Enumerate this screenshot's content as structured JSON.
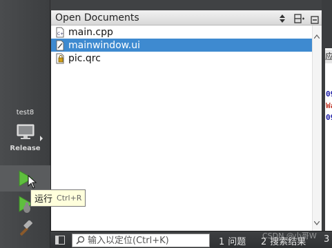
{
  "sidebar": {
    "kit_name": "test8",
    "build_config": "Release",
    "run_tooltip": {
      "label": "运行",
      "shortcut": "Ctrl+R"
    }
  },
  "open_documents": {
    "title": "Open Documents",
    "files": [
      {
        "name": "main.cpp",
        "icon": "cpp-file-icon",
        "selected": false
      },
      {
        "name": "mainwindow.ui",
        "icon": "ui-file-icon",
        "selected": true
      },
      {
        "name": "pic.qrc",
        "icon": "qrc-file-icon",
        "selected": false
      }
    ]
  },
  "right_pane": {
    "tab_label": "应",
    "lines": [
      {
        "text": "09",
        "color": "#1a1aa6"
      },
      {
        "text": "Wa",
        "color": "#c0392b"
      },
      {
        "text": "09",
        "color": "#1a1aa6"
      }
    ]
  },
  "statusbar": {
    "locator_placeholder": "输入以定位(Ctrl+K)",
    "tabs": [
      {
        "num": "1",
        "label": "问题"
      },
      {
        "num": "2",
        "label": "搜索结果"
      },
      {
        "num": "3",
        "label": ""
      }
    ],
    "watermark": "CSDN @小哥W"
  },
  "colors": {
    "selection": "#3e8ad0",
    "run_green": "#5fbf3e",
    "sidebar_bg": "#45474a",
    "tooltip_bg": "#ffffdc"
  }
}
